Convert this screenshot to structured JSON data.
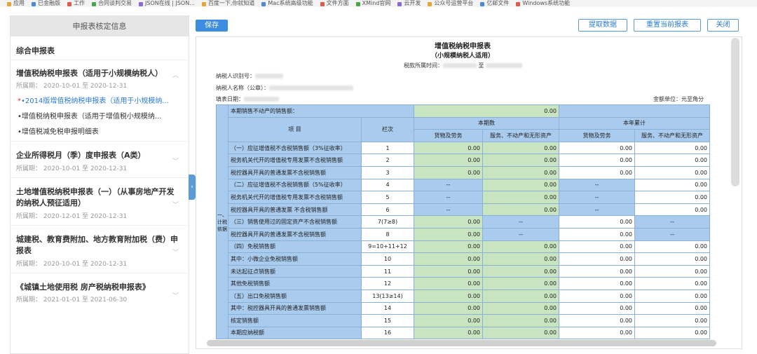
{
  "bookmarks": [
    "应用",
    "已金融版",
    "工作",
    "合同谈判交易",
    "JSON在线 | JSON...",
    "百度一下,你就知道",
    "Mac系统高级功能",
    "文件方面",
    "XMind官网",
    "云开发",
    "公众号运营平台",
    "亿邮文件",
    "Windows系统功能"
  ],
  "sidebar": {
    "header": "申报表核定信息",
    "top": "综合申报表",
    "sections": [
      {
        "title": "增值税纳税申报表（适用于小规模纳税人）",
        "period": "所属期：  2020-10-01 至 2020-12-31",
        "subs": [
          {
            "star": "*",
            "label": "•2014版增值税纳税申报表（适用于小规模纳..."
          },
          {
            "label": "•增值税纳税申报表（适用于增值税小规模纳..."
          },
          {
            "label": "•增值税减免税申报明细表"
          }
        ]
      },
      {
        "title": "企业所得税月（季）度申报表（A类）",
        "period": "所属期：  2020-10-01 至 2020-12-31"
      },
      {
        "title": "土地增值税纳税申报表（一）（从事房地产开发",
        "title2": "的纳税人预征适用）",
        "period": "所属期：  2020-12-01 至 2020-12-31"
      },
      {
        "title": "城建税、教育费附加、地方教育附加税（费）申",
        "title2": "报表",
        "period": "所属期：  2020-10-01 至 2020-12-31"
      },
      {
        "title": "《城镇土地使用税 房产税纳税申报表》",
        "period": "所属期：  2021-01-01 至 2021-06-30"
      }
    ]
  },
  "toolbar": {
    "save": "保存",
    "fetch": "提取数据",
    "reset": "重置当前报表",
    "close": "关闭"
  },
  "form": {
    "title": "增值税纳税申报表",
    "subtitle": "（小规模纳税人适用）",
    "period_label": "税款所属时间：",
    "period_sep": "至",
    "taxpayer_id_label": "纳税人识别号：",
    "taxpayer_name_label": "纳税人名称（公章）：",
    "fill_date_label": "填表日期：",
    "unit": "金额单位：元至角分",
    "property_sales_label": "本期销售不动产的销售额：",
    "property_sales_value": "0.00",
    "side_label": "一、计税依据",
    "col_item": "项 目",
    "col_line": "栏次",
    "col_current": "本期数",
    "col_ytd": "本年累计",
    "col_goods": "货物及劳务",
    "col_services": "服务、不动产和无形资产",
    "rows": [
      {
        "label": "（一）应征增值税不含税销售额（3%征收率）",
        "line": "1",
        "v": [
          "0.00",
          "0.00",
          "0.00",
          "0.00"
        ]
      },
      {
        "label": "税务机关代开的增值税专用发票不含税销售额",
        "line": "2",
        "v": [
          "0.00",
          "0.00",
          "0.00",
          "0.00"
        ]
      },
      {
        "label": "税控器具开具的普通发票不含税销售额",
        "line": "3",
        "v": [
          "0.00",
          "0.00",
          "0.00",
          "0.00"
        ]
      },
      {
        "label": "（二）应征增值税不含税销售额（5%征收率）",
        "line": "4",
        "v": [
          "--",
          "0.00",
          "--",
          "0.00"
        ]
      },
      {
        "label": "税务机关代开的增值税专用发票不含税销售额",
        "line": "5",
        "v": [
          "--",
          "0.00",
          "--",
          "0.00"
        ]
      },
      {
        "label": "税控器具开具的普通发票 不含税销售额",
        "line": "6",
        "v": [
          "--",
          "0.00",
          "--",
          "0.00"
        ]
      },
      {
        "label": "（三）销售使用过的固定资产不含税销售额",
        "line": "7(7≥8)",
        "v": [
          "0.00",
          "--",
          "0.00",
          "--"
        ]
      },
      {
        "label": "税控器具开具的普通发票不含税销售额",
        "line": "8",
        "v": [
          "0.00",
          "--",
          "0.00",
          "--"
        ]
      },
      {
        "label": "（四）免税销售额",
        "line": "9=10+11+12",
        "v": [
          "0.00",
          "0.00",
          "0.00",
          "0.00"
        ]
      },
      {
        "label": "其中：小微企业免税销售额",
        "line": "10",
        "v": [
          "0.00",
          "0.00",
          "0.00",
          "0.00"
        ]
      },
      {
        "label": "未达起征点销售额",
        "line": "11",
        "v": [
          "0.00",
          "0.00",
          "0.00",
          "0.00"
        ]
      },
      {
        "label": "其他免税销售额",
        "line": "12",
        "v": [
          "0.00",
          "0.00",
          "0.00",
          "0.00"
        ]
      },
      {
        "label": "（五）出口免税销售额",
        "line": "13(13≥14)",
        "v": [
          "0.00",
          "0.00",
          "0.00",
          "0.00"
        ]
      },
      {
        "label": "其中：税控器具开具的普通发票销售额",
        "line": "14",
        "v": [
          "0.00",
          "0.00",
          "0.00",
          "0.00"
        ]
      },
      {
        "label": "核定销售额",
        "line": "15",
        "v": [
          "0.00",
          "0.00",
          "0.00",
          "0.00"
        ]
      },
      {
        "label": "本期应纳税额",
        "line": "16",
        "v": [
          "0.00",
          "0.00",
          "0.00",
          "0.00"
        ]
      }
    ]
  }
}
